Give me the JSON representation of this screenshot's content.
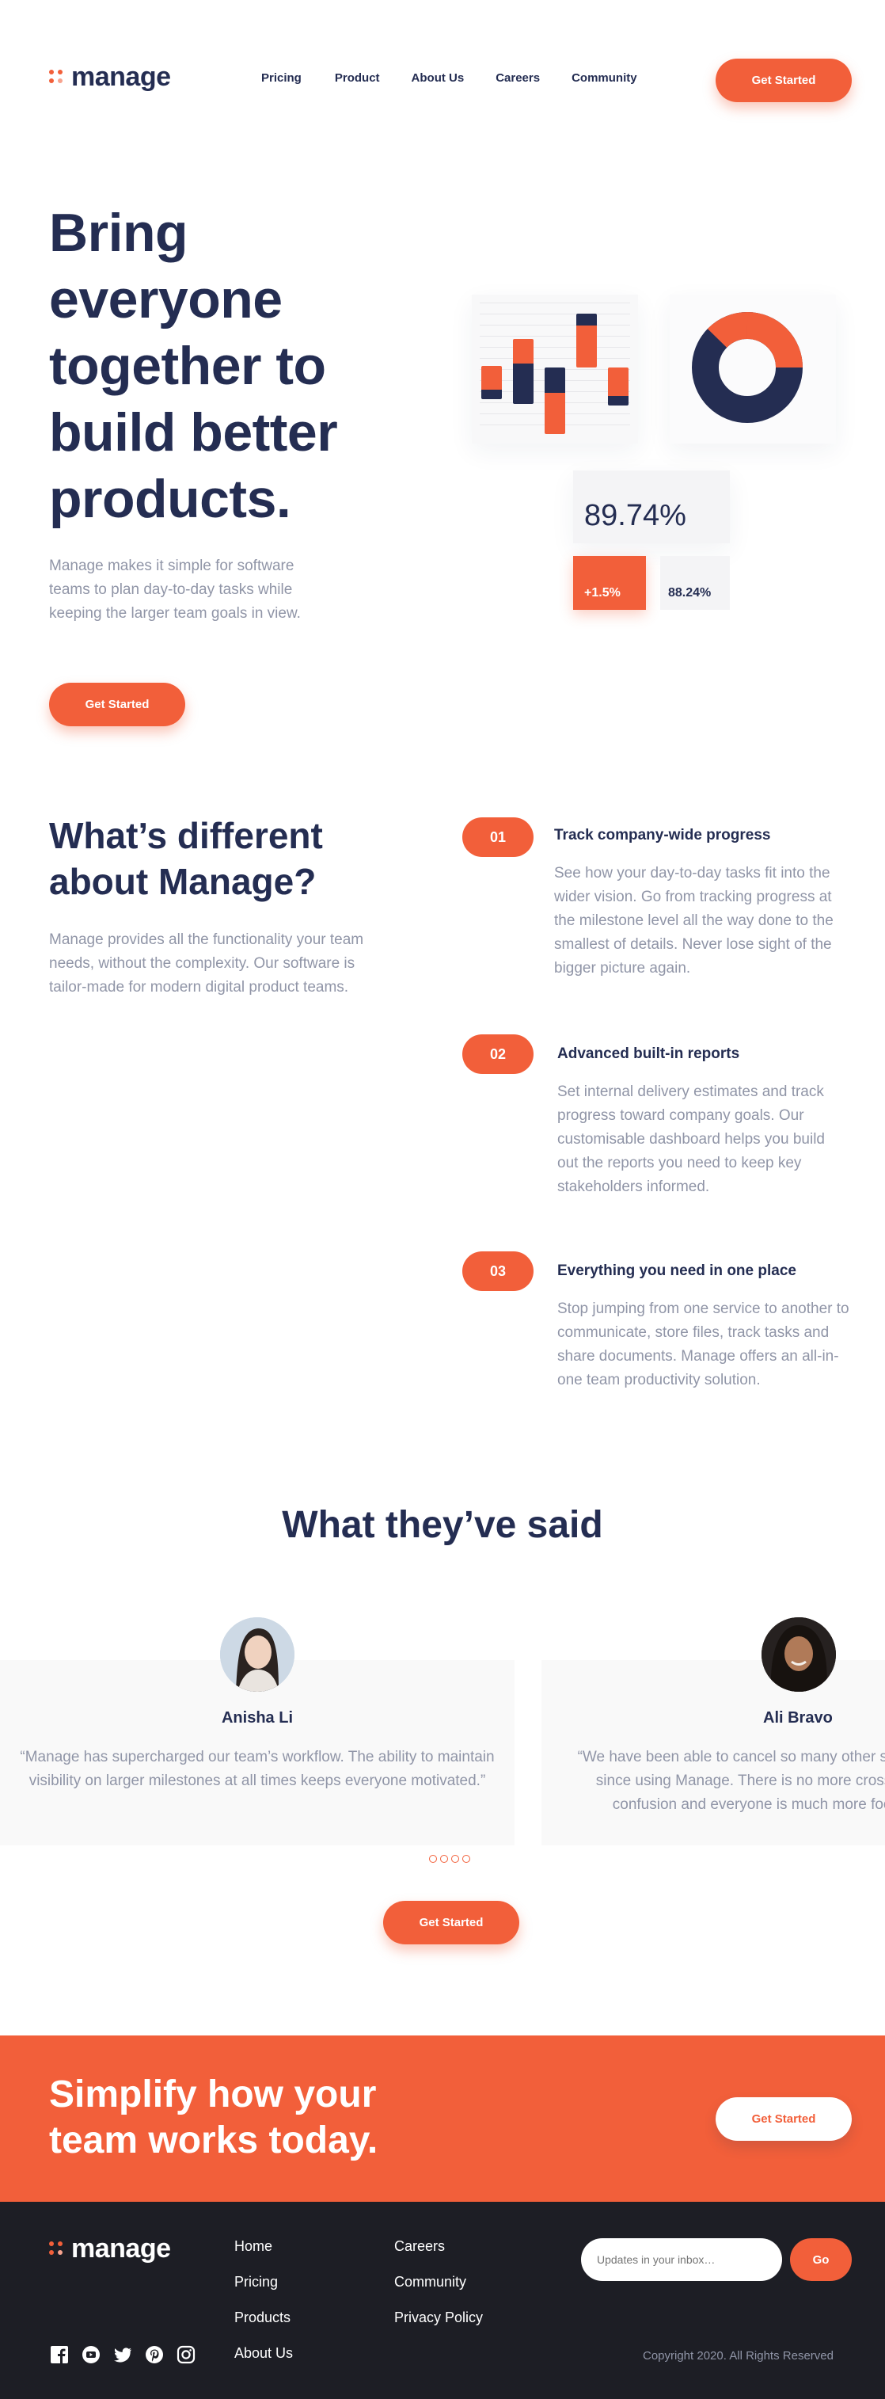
{
  "brand": {
    "name": "manage",
    "accent": "#f25f3a",
    "navy": "#242d52"
  },
  "nav": {
    "items": [
      "Pricing",
      "Product",
      "About Us",
      "Careers",
      "Community"
    ],
    "cta": "Get Started"
  },
  "hero": {
    "title": "Bring everyone together to build better products.",
    "description": "Manage makes it simple for software teams to plan day-to-day tasks while keeping the larger team goals in view.",
    "cta": "Get Started",
    "stats": {
      "main": "89.74%",
      "change": "+1.5%",
      "secondary": "88.24%"
    }
  },
  "features": {
    "title": "What’s different about Manage?",
    "description": "Manage provides all the functionality your team needs, without the complexity. Our software is tailor-made for modern digital product teams.",
    "items": [
      {
        "num": "01",
        "title": "Track company-wide progress",
        "body": "See how your day-to-day tasks fit into the wider vision. Go from tracking progress at the milestone level all the way done to the smallest of details. Never lose sight of the bigger picture again."
      },
      {
        "num": "02",
        "title": "Advanced built-in reports",
        "body": "Set internal delivery estimates and track progress toward company goals. Our customisable dashboard helps you build out the reports you need to keep key stakeholders informed."
      },
      {
        "num": "03",
        "title": "Everything you need in one place",
        "body": "Stop jumping from one service to another to communicate, store files, track tasks and share documents. Manage offers an all-in-one team productivity solution."
      }
    ]
  },
  "testimonials": {
    "title": "What they’ve said",
    "items": [
      {
        "name": "Anisha Li",
        "quote": "“Manage has supercharged our team’s workflow. The ability to maintain visibility on larger milestones at all times keeps everyone motivated.”"
      },
      {
        "name": "Ali Bravo",
        "quote": "“We have been able to cancel so many other subscriptions since using Manage. There is no more cross-channel confusion and everyone is much more focused.”"
      }
    ],
    "cta": "Get Started"
  },
  "cta_banner": {
    "title": "Simplify how your team works today.",
    "cta": "Get Started"
  },
  "footer": {
    "col1": [
      "Home",
      "Pricing",
      "Products",
      "About Us"
    ],
    "col2": [
      "Careers",
      "Community",
      "Privacy Policy"
    ],
    "social_icons": [
      "facebook-icon",
      "youtube-icon",
      "twitter-icon",
      "pinterest-icon",
      "instagram-icon"
    ],
    "newsletter": {
      "placeholder": "Updates in your inbox…",
      "button": "Go"
    },
    "copyright": "Copyright 2020. All Rights Reserved"
  }
}
